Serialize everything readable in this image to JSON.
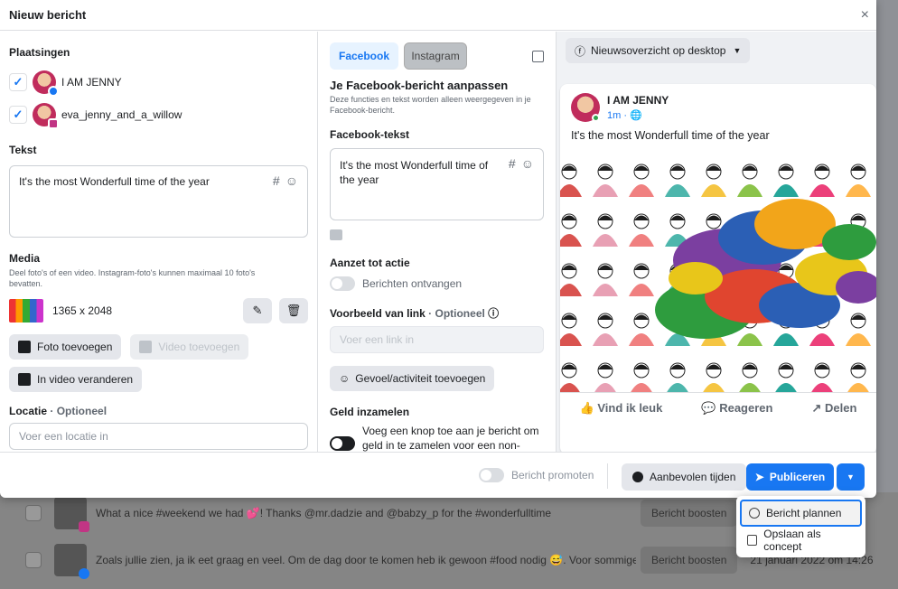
{
  "modal": {
    "title": "Nieuw bericht",
    "close": "×"
  },
  "placements": {
    "heading": "Plaatsingen",
    "items": [
      {
        "name": "I AM JENNY",
        "network": "facebook"
      },
      {
        "name": "eva_jenny_and_a_willow",
        "network": "instagram"
      }
    ]
  },
  "text": {
    "heading": "Tekst",
    "value": "It's the most Wonderfull time of the year"
  },
  "media": {
    "heading": "Media",
    "description": "Deel foto's of een video. Instagram-foto's kunnen maximaal 10 foto's bevatten.",
    "dimensions": "1365 x 2048",
    "add_photo": "Foto toevoegen",
    "add_video": "Video toevoegen",
    "convert_video": "In video veranderen"
  },
  "location": {
    "heading": "Locatie",
    "optional": "· Optioneel",
    "placeholder": "Voer een locatie in"
  },
  "tabs": [
    {
      "label": "Facebook"
    },
    {
      "label": "Instagram"
    }
  ],
  "customize": {
    "heading": "Je Facebook-bericht aanpassen",
    "description": "Deze functies en tekst worden alleen weergegeven in je Facebook-bericht.",
    "fb_text_heading": "Facebook-tekst",
    "fb_text": "It's the most Wonderfull time of the year",
    "cta_heading": "Aanzet tot actie",
    "cta_option": "Berichten ontvangen",
    "link_heading": "Voorbeeld van link",
    "link_optional": "· Optioneel",
    "link_placeholder": "Voer een link in",
    "feeling": "Gevoel/activiteit toevoegen",
    "fundraise_heading": "Geld inzamelen",
    "fundraise_text": "Voeg een knop toe aan je bericht om geld in te zamelen voor een non-"
  },
  "preview": {
    "placement": "Nieuwsoverzicht op desktop",
    "page": "I AM JENNY",
    "time": "1m ·",
    "text": "It's the most Wonderfull time of the year",
    "like": "Vind ik leuk",
    "comment": "Reageren",
    "share": "Delen"
  },
  "footer": {
    "promote": "Bericht promoten",
    "recommended": "Aanbevolen tijden",
    "publish": "Publiceren"
  },
  "dropdown": [
    {
      "label": "Bericht plannen"
    },
    {
      "label": "Opslaan als concept"
    }
  ],
  "background_rows": [
    {
      "text": "What a nice #weekend we had 💕! Thanks @mr.dadzie and @babzy_p for the #wonderfulltime",
      "boost": "Bericht boosten",
      "date": ""
    },
    {
      "text": "Zoals jullie zien, ja ik eet graag en veel. Om de dag door te komen heb ik gewoon #food nodig 😅. Voor sommige is #...",
      "boost": "Bericht boosten",
      "date": "21 januari 2022 om 14:26"
    }
  ],
  "colors": {
    "accent": "#1877f2",
    "instagram": "#c13584"
  }
}
